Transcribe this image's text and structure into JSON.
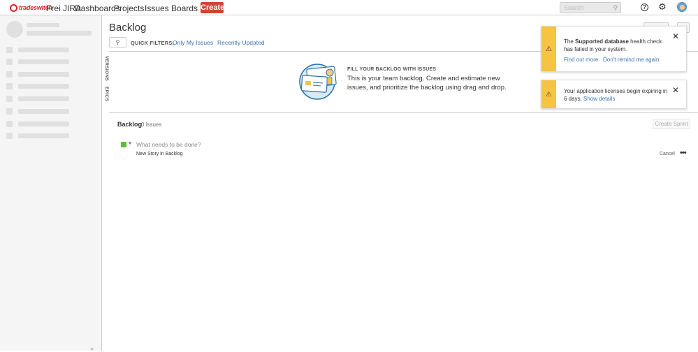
{
  "brand": {
    "logo_text": "tradeswitch",
    "accent": "#d04437"
  },
  "nav": {
    "items": [
      "Frei JIRA",
      "Dashboards",
      "Projects",
      "Issues",
      "Boards"
    ],
    "create_label": "Create",
    "search_placeholder": "Search"
  },
  "header_icons": [
    "help-icon",
    "gear-icon",
    "avatar"
  ],
  "page": {
    "title": "Backlog",
    "quick_filters_label": "QUICK FILTERS:",
    "quick_filters": [
      "Only My Issues",
      "Recently Updated"
    ]
  },
  "side_tabs": [
    "VERSIONS",
    "EPICS"
  ],
  "empty_state": {
    "heading": "FILL YOUR BACKLOG WITH ISSUES",
    "text": "This is your team backlog. Create and estimate new issues, and prioritize the backlog using drag and drop."
  },
  "backlog": {
    "title": "Backlog",
    "count": "0 issues",
    "create_sprint_label": "Create Sprint",
    "inline_placeholder": "What needs to be done?",
    "inline_hint": "New Story in Backlog",
    "cancel_label": "Cancel",
    "story_color": "#63ba3c"
  },
  "flags": [
    {
      "text_pre": "The ",
      "text_bold": "Supported database",
      "text_post": " health check has failed in your system.",
      "link1": "Find out more",
      "link2": "Don't remind me again"
    },
    {
      "text": "Your application licenses begin expiring in 6 days. ",
      "link": "Show details"
    }
  ],
  "flag_accent": "#f6c342"
}
